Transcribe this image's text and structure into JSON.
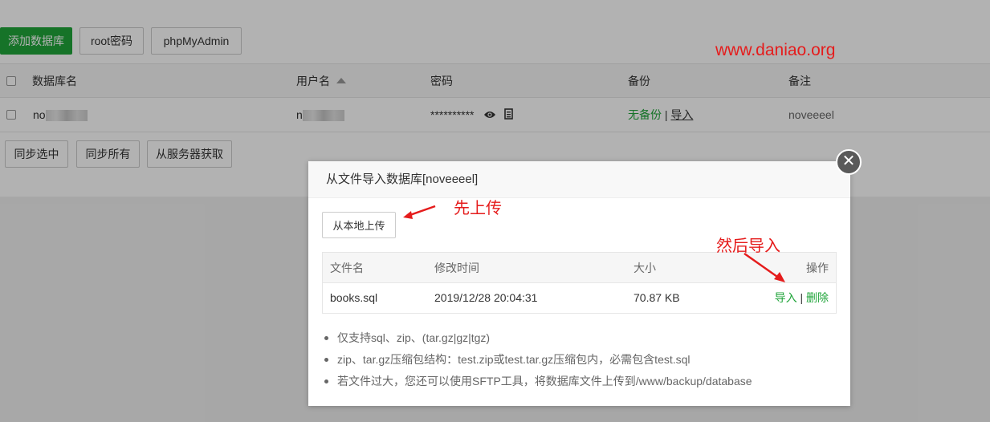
{
  "toolbar": {
    "add_db": "添加数据库",
    "root_pwd": "root密码",
    "phpmyadmin": "phpMyAdmin"
  },
  "table": {
    "headers": {
      "name": "数据库名",
      "user": "用户名",
      "password": "密码",
      "backup": "备份",
      "remark": "备注"
    },
    "row": {
      "name_prefix": "no",
      "user_prefix": "n",
      "password_mask": "**********",
      "backup_status": "无备份",
      "separator": "|",
      "import_link": "导入",
      "remark": "noveeeel"
    }
  },
  "actions": {
    "sync_selected": "同步选中",
    "sync_all": "同步所有",
    "fetch_from_server": "从服务器获取"
  },
  "watermark": "www.daniao.org",
  "modal": {
    "title": "从文件导入数据库[noveeeel]",
    "upload_button": "从本地上传",
    "file_table": {
      "headers": {
        "filename": "文件名",
        "mtime": "修改时间",
        "size": "大小",
        "ops": "操作"
      },
      "rows": [
        {
          "filename": "books.sql",
          "mtime": "2019/12/28 20:04:31",
          "size": "70.87 KB",
          "import": "导入",
          "separator": "|",
          "delete": "删除"
        }
      ]
    },
    "notes": [
      "仅支持sql、zip、(tar.gz|gz|tgz)",
      "zip、tar.gz压缩包结构：test.zip或test.tar.gz压缩包内，必需包含test.sql",
      "若文件过大，您还可以使用SFTP工具，将数据库文件上传到/www/backup/database"
    ]
  },
  "annotations": {
    "first_upload": "先上传",
    "then_import": "然后导入"
  },
  "colors": {
    "accent_green": "#20a53a",
    "annotation_red": "#e51c1c"
  }
}
